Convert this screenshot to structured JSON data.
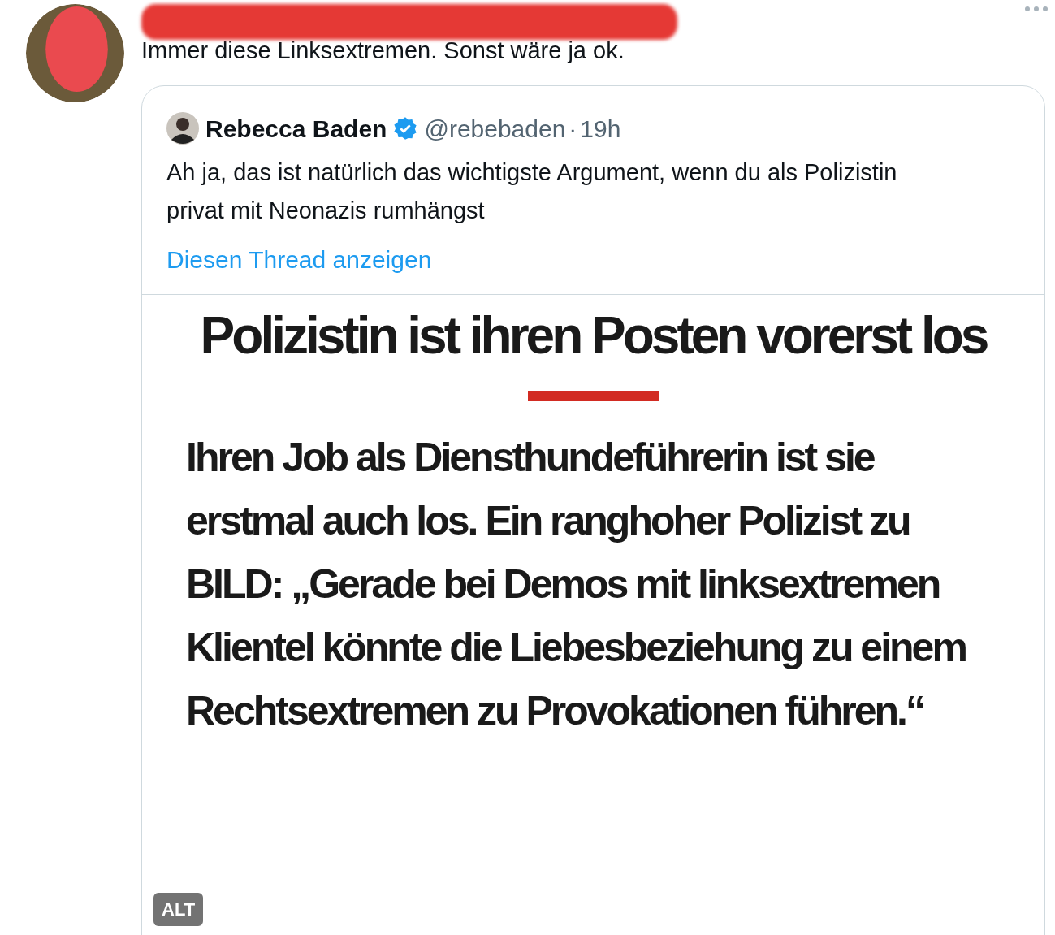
{
  "tweet": {
    "author_redacted": true,
    "text": "Immer diese Linksextremen. Sonst wäre ja ok.",
    "quoted": {
      "name": "Rebecca Baden",
      "verified": true,
      "handle": "@rebebaden",
      "separator": "·",
      "time": "19h",
      "text": "Ah ja, das ist natürlich das wichtigste Argument, wenn du als Polizistin privat mit Neonazis rumhängst",
      "thread_link": "Diesen Thread anzeigen",
      "image": {
        "headline": "Polizistin ist ihren Posten vorerst los",
        "body": "Ihren Job als Diensthundeführerin ist sie erstmal auch los. Ein ranghoher Polizist zu BILD: „Gerade bei Demos mit linksextremen Klientel könnte die Liebesbeziehung zu einem Rechtsextremen zu Provokationen führen.“",
        "alt_badge": "ALT"
      }
    }
  }
}
